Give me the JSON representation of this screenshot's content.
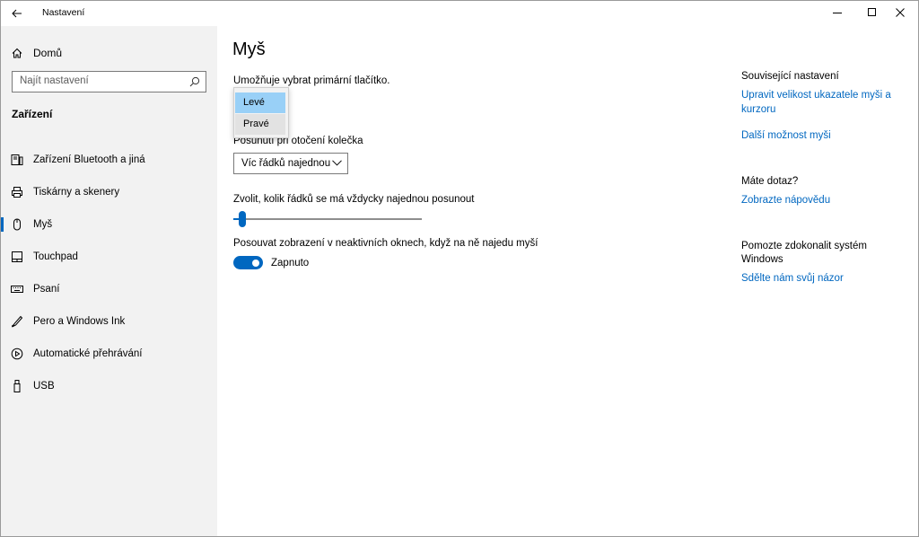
{
  "window": {
    "title": "Nastavení",
    "back_icon": "arrow-left-icon",
    "controls": [
      "minimize-icon",
      "maximize-icon",
      "close-icon"
    ]
  },
  "sidebar": {
    "home_label": "Domů",
    "search_placeholder": "Najít nastavení",
    "section_title": "Zařízení",
    "items": [
      {
        "label": "Zařízení Bluetooth a jiná",
        "icon": "devices-icon",
        "selected": false
      },
      {
        "label": "Tiskárny a skenery",
        "icon": "printer-icon",
        "selected": false
      },
      {
        "label": "Myš",
        "icon": "mouse-icon",
        "selected": true
      },
      {
        "label": "Touchpad",
        "icon": "touchpad-icon",
        "selected": false
      },
      {
        "label": "Psaní",
        "icon": "keyboard-icon",
        "selected": false
      },
      {
        "label": "Pero a Windows Ink",
        "icon": "pen-icon",
        "selected": false
      },
      {
        "label": "Automatické přehrávání",
        "icon": "autoplay-icon",
        "selected": false
      },
      {
        "label": "USB",
        "icon": "usb-icon",
        "selected": false
      }
    ]
  },
  "main": {
    "title": "Myš",
    "primary_button_label": "Umožňuje vybrat primární tlačítko.",
    "primary_button_options": [
      "Levé",
      "Pravé"
    ],
    "primary_button_selected": "Levé",
    "scroll_label": "Posunutí při otočení kolečka",
    "scroll_value": "Víc řádků najednou",
    "lines_label": "Zvolit, kolik řádků se má vždycky najednou posunout",
    "lines_slider_fraction": 0.03,
    "inactive_label": "Posouvat zobrazení v neaktivních oknech, když na ně najedu myší",
    "inactive_toggle_label": "Zapnuto",
    "inactive_toggle_on": true
  },
  "right": {
    "related_title": "Související nastavení",
    "related_link1": "Upravit velikost ukazatele myši a kurzoru",
    "related_link2": "Další možnost myši",
    "question_title": "Máte dotaz?",
    "question_link": "Zobrazte nápovědu",
    "improve_title": "Pomozte zdokonalit systém Windows",
    "improve_link": "Sdělte nám svůj názor"
  },
  "colors": {
    "accent": "#0067c0",
    "sidebar_bg": "#f2f2f2",
    "selected_option_bg": "#99d0f7"
  }
}
